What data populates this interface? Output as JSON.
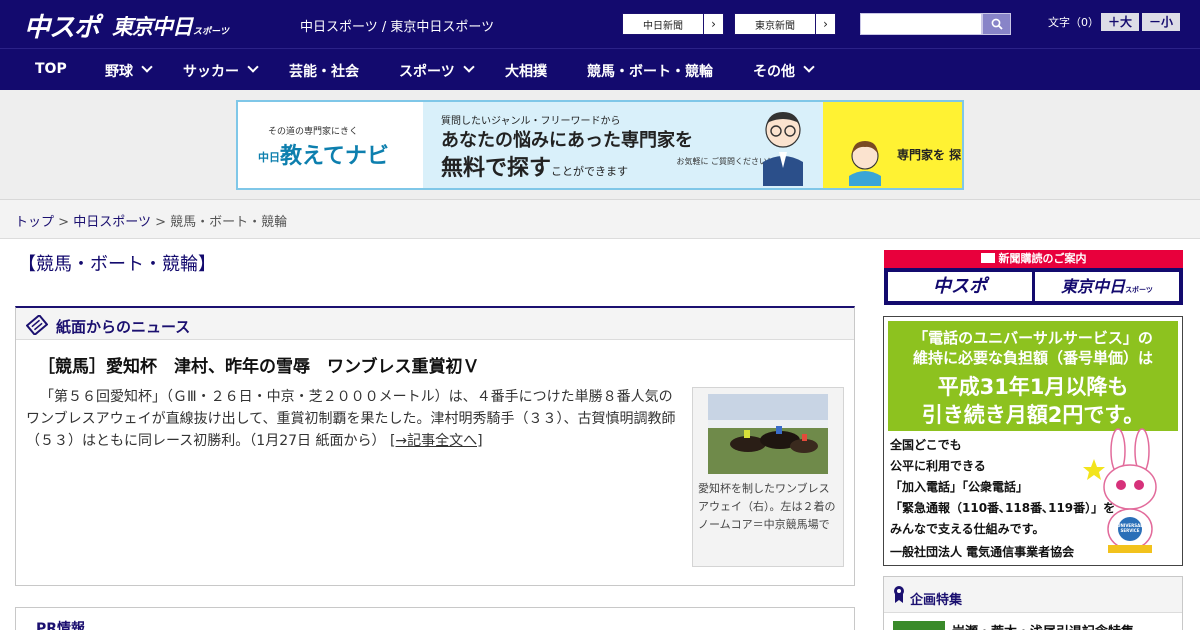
{
  "header": {
    "logo_chuspo": "中スポ",
    "logo_tokyo": "東京中日",
    "logo_tokyo_suffix": "スポーツ",
    "site_link": "中日スポーツ / 東京中日スポーツ",
    "paper_buttons": [
      {
        "label": "中日新聞",
        "arrow": "›"
      },
      {
        "label": "東京新聞",
        "arrow": "›"
      }
    ],
    "search": {
      "value": "",
      "placeholder": ""
    },
    "font_size_label": "文字（0）",
    "font_larger": "＋大",
    "font_smaller": "－小"
  },
  "nav": {
    "items": [
      {
        "label": "TOP",
        "has_dropdown": false
      },
      {
        "label": "野球",
        "has_dropdown": true
      },
      {
        "label": "サッカー",
        "has_dropdown": true
      },
      {
        "label": "芸能・社会",
        "has_dropdown": false
      },
      {
        "label": "スポーツ",
        "has_dropdown": true
      },
      {
        "label": "大相撲",
        "has_dropdown": false
      },
      {
        "label": "競馬・ボート・競輪",
        "has_dropdown": false
      },
      {
        "label": "その他",
        "has_dropdown": true
      }
    ]
  },
  "ad_banner": {
    "small_text": "その道の専門家にきく",
    "brand": "教えてナビ",
    "brand_prefix": "中日",
    "line1": "質問したいジャンル・フリーワードから",
    "line2": "あなたの悩みにあった専門家を",
    "line3_main": "無料で探す",
    "line3_small": "ことができます",
    "note": "お気軽に ご質問ください！",
    "cta": "専門家を 探す →",
    "colors": {
      "border": "#7fc7e8",
      "brand": "#0d7fae",
      "panel": "#d9f0fa",
      "cta_bg": "#fff233"
    }
  },
  "breadcrumb": {
    "items": [
      "トップ",
      "中日スポーツ"
    ],
    "separator": ">",
    "current": "競馬・ボート・競輪"
  },
  "page_title": "【競馬・ボート・競輪】",
  "news_section": {
    "heading": "紙面からのニュース",
    "article": {
      "title": "［競馬］愛知杯　津村、昨年の雪辱　ワンブレス重賞初Ｖ",
      "body": "「第５６回愛知杯」（ＧⅢ・２６日・中京・芝２０００メートル）は、４番手につけた単勝８番人気のワンブレスアウェイが直線抜け出して、重賞初制覇を果たした。津村明秀騎手（３３）、古賀慎明調教師（５３）はともに同レース初勝利。（1月27日 紙面から）",
      "link_text": "[→記事全文へ]",
      "photo_caption": "愛知杯を制したワンブレスアウェイ（右）。左は２着のノームコア＝中京競馬場で"
    }
  },
  "pr_section": {
    "heading": "PR情報"
  },
  "sidebar": {
    "subscription": {
      "title": "新聞購読のご案内",
      "logo_left": "中スポ",
      "logo_right": "東京中日",
      "logo_right_suffix": "スポーツ"
    },
    "universal_ad": {
      "line1": "「電話のユニバーサルサービス」の",
      "line2": "維持に必要な負担額（番号単価）は",
      "line3": "平成31年1月以降も",
      "line4": "引き続き月額2円です。",
      "body": [
        "全国どこでも",
        "公平に利用できる",
        "「加入電話」「公衆電話」",
        "「緊急通報（110番､118番､119番）」を",
        "みんなで支える仕組みです。"
      ],
      "org": "一般社団法人 電気通信事業者協会",
      "mascot_badge": "UNIVERSAL SERVICE",
      "colors": {
        "green": "#8dc21f"
      }
    },
    "feature": {
      "heading": "企画特集",
      "item": "岩瀬・荒木・浅尾引退記念特集"
    }
  },
  "colors": {
    "brand_navy": "#130a6e",
    "accent_red": "#e8003c"
  }
}
